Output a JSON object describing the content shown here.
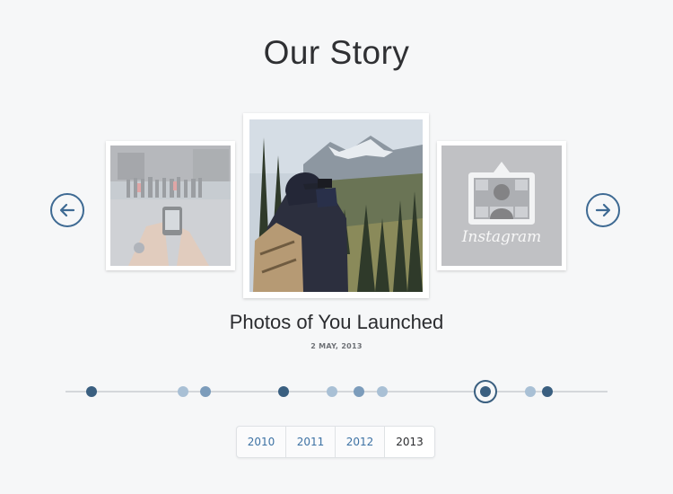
{
  "page": {
    "title": "Our Story"
  },
  "carousel": {
    "prev_icon": "arrow-left-icon",
    "next_icon": "arrow-right-icon",
    "cards": [
      {
        "position": "left",
        "image": "street-crowd-photo"
      },
      {
        "position": "center",
        "image": "mountain-hiker-photo"
      },
      {
        "position": "right",
        "image": "instagram-logo",
        "logo_text": "Instagram"
      }
    ]
  },
  "event": {
    "title": "Photos of You Launched",
    "date": "2 MAY, 2013"
  },
  "timeline": {
    "dots": [
      {
        "tone": "dark"
      },
      {
        "tone": "light"
      },
      {
        "tone": "mid"
      },
      {
        "tone": "dark"
      },
      {
        "tone": "light"
      },
      {
        "tone": "mid"
      },
      {
        "tone": "light"
      },
      {
        "tone": "active"
      },
      {
        "tone": "light"
      },
      {
        "tone": "dark"
      }
    ]
  },
  "years": {
    "items": [
      "2010",
      "2011",
      "2012",
      "2013"
    ],
    "selected": "2013"
  },
  "colors": {
    "accent": "#3e6a93",
    "dot_dark": "#3a5f80",
    "dot_light": "#a9c0d5",
    "link": "#3d72a4"
  }
}
